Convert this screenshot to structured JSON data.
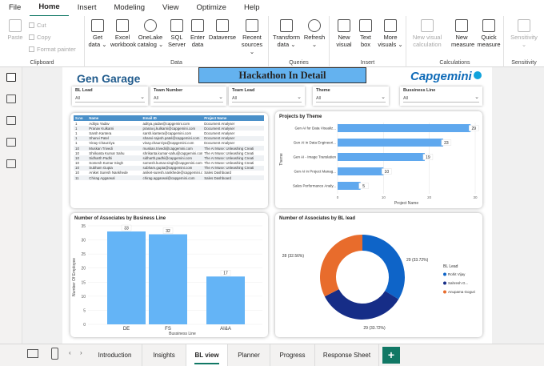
{
  "menu": [
    "File",
    "Home",
    "Insert",
    "Modeling",
    "View",
    "Optimize",
    "Help"
  ],
  "ribbon": {
    "clipboard": {
      "paste": "Paste",
      "cut": "Cut",
      "copy": "Copy",
      "format_painter": "Format painter",
      "group": "Clipboard"
    },
    "data": {
      "items": [
        "Get data ⌄",
        "Excel workbook",
        "OneLake catalog ⌄",
        "SQL Server",
        "Enter data",
        "Dataverse",
        "Recent sources ⌄"
      ],
      "group": "Data"
    },
    "queries": {
      "items": [
        "Transform data ⌄",
        "Refresh ⌄"
      ],
      "group": "Queries"
    },
    "insert": {
      "items": [
        "New visual",
        "Text box",
        "More visuals ⌄"
      ],
      "group": "Insert"
    },
    "calculations": {
      "items": [
        "New visual calculation",
        "New measure",
        "Quick measure"
      ],
      "group": "Calculations"
    },
    "sensitivity": {
      "items": [
        "Sensitivity ⌄"
      ],
      "group": "Sensitivity"
    }
  },
  "report": {
    "brand": "Gen Garage",
    "heading": "Hackathon In Detail",
    "logo_text": "Capgemini",
    "slicers": [
      {
        "title": "BL Lead",
        "value": "All"
      },
      {
        "title": "Team Number",
        "value": "All"
      },
      {
        "title": "Team Lead",
        "value": "All"
      },
      {
        "title": "Theme",
        "value": "All"
      },
      {
        "title": "Bussiness Line",
        "value": "All"
      }
    ],
    "table": {
      "columns": [
        "S.no",
        "Name",
        "Email ID",
        "Project Name"
      ],
      "rows": [
        [
          "1",
          "Aditya Yadav",
          "aditya.yadav@capgemini.com",
          "Document Analyser"
        ],
        [
          "1",
          "Pranav Kulkarni",
          "pranav.j.kulkarni@capgemini.com",
          "Document Analyser"
        ],
        [
          "1",
          "Sarsh Kantera",
          "sarsh.kantera@capgemini.com",
          "Document Analyser"
        ],
        [
          "1",
          "Shanvi Patel",
          "shanvi-rajesh.patel@capgemini.com",
          "Document Analyser"
        ],
        [
          "1",
          "Vinay Chaurziya",
          "vinay.chaurziya@capgemini.com",
          "Document Analyser"
        ],
        [
          "10",
          "Muskan Trivedi",
          "muskan.trivedi@capgemini.com",
          "The AI Muse: Unleashing Creati"
        ],
        [
          "10",
          "Shrikanta Kumar Sahu",
          "shrikanta.kumar-sahu@capgemini.com",
          "The AI Muse: Unleashing Creati"
        ],
        [
          "10",
          "Sidharth Padhi",
          "sidharth.padhi@capgemini.com",
          "The AI Muse: Unleashing Creati"
        ],
        [
          "10",
          "Somesh Kumar Singh",
          "somesh.kumar.singh@capgemini.com",
          "The AI Muse: Unleashing Creati"
        ],
        [
          "10",
          "Subham Gupta",
          "subham.gupta@capgemini.com",
          "The AI Muse: Unleashing Creati"
        ],
        [
          "10",
          "Aniket Suresh Nankhede",
          "aniket-suresh.nankhede@capgemini.com",
          "Sales Dashboard"
        ],
        [
          "11",
          "Chirag Aggarwal",
          "chirag.aggarwal@capgemini.com",
          "Sales Dashboard"
        ]
      ]
    },
    "projects_chart": {
      "title": "Projects by Theme",
      "xlabel": "Project Name",
      "ylabel": "Theme",
      "xticks": [
        "0",
        "10",
        "20",
        "30"
      ]
    },
    "business_chart": {
      "title": "Number of Associates by Business Line",
      "xlabel": "Bussiness Line",
      "ylabel": "Number Of Employee",
      "yticks": [
        "0",
        "5",
        "10",
        "15",
        "20",
        "25",
        "30",
        "35"
      ]
    },
    "bl_chart": {
      "title": "Number of Associates by BL lead",
      "legend_title": "BL Lead",
      "data_labels": [
        "29 (33.72%)",
        "28 (32.56%)",
        "29 (33.72%)"
      ]
    }
  },
  "chart_data": [
    {
      "type": "bar",
      "title": "Projects by Theme",
      "orientation": "horizontal",
      "categories": [
        "Gen AI for Data Visualiz...",
        "Gen AI in Data Engineeri...",
        "Gen AI - Image Translation",
        "Gen AI in Project Manag...",
        "Sales Performance Analy..."
      ],
      "values": [
        29,
        23,
        19,
        10,
        5
      ],
      "xlabel": "Project Name",
      "ylabel": "Theme",
      "xlim": [
        0,
        30
      ],
      "color": "#5fa8ee"
    },
    {
      "type": "bar",
      "title": "Number of Associates by Business Line",
      "categories": [
        "DE",
        "FS",
        "AI&A"
      ],
      "values": [
        33,
        32,
        17
      ],
      "xlabel": "Bussiness Line",
      "ylabel": "Number Of Employee",
      "ylim": [
        0,
        35
      ],
      "color": "#64b4f6"
    },
    {
      "type": "pie",
      "title": "Number of Associates by BL lead",
      "categories": [
        "Rohit Vijay",
        "Sahresh G...",
        "Anupama Goguri"
      ],
      "values": [
        29,
        29,
        28
      ],
      "colors": [
        "#0e64c8",
        "#162d87",
        "#e86c2c"
      ],
      "legend": "right"
    }
  ],
  "pages": [
    "Introduction",
    "Insights",
    "BL view",
    "Planner",
    "Progress",
    "Response Sheet"
  ],
  "active_page": "BL view"
}
